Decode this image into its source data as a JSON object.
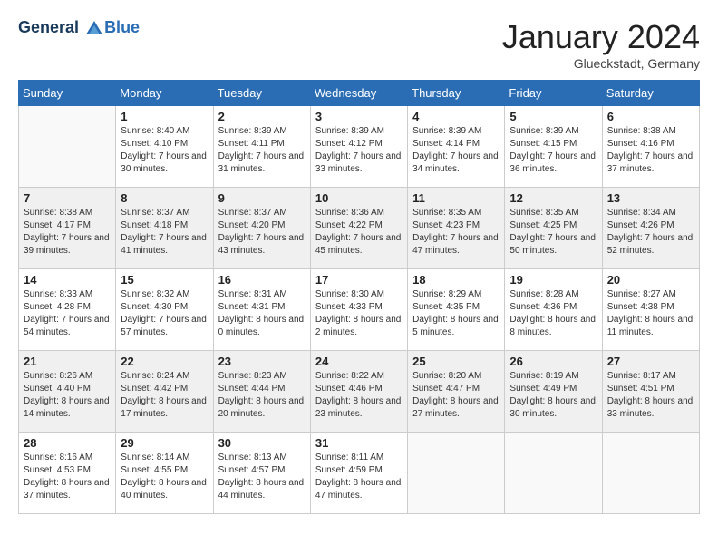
{
  "header": {
    "logo_line1": "General",
    "logo_line2": "Blue",
    "month_title": "January 2024",
    "location": "Glueckstadt, Germany"
  },
  "weekdays": [
    "Sunday",
    "Monday",
    "Tuesday",
    "Wednesday",
    "Thursday",
    "Friday",
    "Saturday"
  ],
  "weeks": [
    [
      {
        "day": "",
        "sunrise": "",
        "sunset": "",
        "daylight": ""
      },
      {
        "day": "1",
        "sunrise": "Sunrise: 8:40 AM",
        "sunset": "Sunset: 4:10 PM",
        "daylight": "Daylight: 7 hours and 30 minutes."
      },
      {
        "day": "2",
        "sunrise": "Sunrise: 8:39 AM",
        "sunset": "Sunset: 4:11 PM",
        "daylight": "Daylight: 7 hours and 31 minutes."
      },
      {
        "day": "3",
        "sunrise": "Sunrise: 8:39 AM",
        "sunset": "Sunset: 4:12 PM",
        "daylight": "Daylight: 7 hours and 33 minutes."
      },
      {
        "day": "4",
        "sunrise": "Sunrise: 8:39 AM",
        "sunset": "Sunset: 4:14 PM",
        "daylight": "Daylight: 7 hours and 34 minutes."
      },
      {
        "day": "5",
        "sunrise": "Sunrise: 8:39 AM",
        "sunset": "Sunset: 4:15 PM",
        "daylight": "Daylight: 7 hours and 36 minutes."
      },
      {
        "day": "6",
        "sunrise": "Sunrise: 8:38 AM",
        "sunset": "Sunset: 4:16 PM",
        "daylight": "Daylight: 7 hours and 37 minutes."
      }
    ],
    [
      {
        "day": "7",
        "sunrise": "Sunrise: 8:38 AM",
        "sunset": "Sunset: 4:17 PM",
        "daylight": "Daylight: 7 hours and 39 minutes."
      },
      {
        "day": "8",
        "sunrise": "Sunrise: 8:37 AM",
        "sunset": "Sunset: 4:18 PM",
        "daylight": "Daylight: 7 hours and 41 minutes."
      },
      {
        "day": "9",
        "sunrise": "Sunrise: 8:37 AM",
        "sunset": "Sunset: 4:20 PM",
        "daylight": "Daylight: 7 hours and 43 minutes."
      },
      {
        "day": "10",
        "sunrise": "Sunrise: 8:36 AM",
        "sunset": "Sunset: 4:22 PM",
        "daylight": "Daylight: 7 hours and 45 minutes."
      },
      {
        "day": "11",
        "sunrise": "Sunrise: 8:35 AM",
        "sunset": "Sunset: 4:23 PM",
        "daylight": "Daylight: 7 hours and 47 minutes."
      },
      {
        "day": "12",
        "sunrise": "Sunrise: 8:35 AM",
        "sunset": "Sunset: 4:25 PM",
        "daylight": "Daylight: 7 hours and 50 minutes."
      },
      {
        "day": "13",
        "sunrise": "Sunrise: 8:34 AM",
        "sunset": "Sunset: 4:26 PM",
        "daylight": "Daylight: 7 hours and 52 minutes."
      }
    ],
    [
      {
        "day": "14",
        "sunrise": "Sunrise: 8:33 AM",
        "sunset": "Sunset: 4:28 PM",
        "daylight": "Daylight: 7 hours and 54 minutes."
      },
      {
        "day": "15",
        "sunrise": "Sunrise: 8:32 AM",
        "sunset": "Sunset: 4:30 PM",
        "daylight": "Daylight: 7 hours and 57 minutes."
      },
      {
        "day": "16",
        "sunrise": "Sunrise: 8:31 AM",
        "sunset": "Sunset: 4:31 PM",
        "daylight": "Daylight: 8 hours and 0 minutes."
      },
      {
        "day": "17",
        "sunrise": "Sunrise: 8:30 AM",
        "sunset": "Sunset: 4:33 PM",
        "daylight": "Daylight: 8 hours and 2 minutes."
      },
      {
        "day": "18",
        "sunrise": "Sunrise: 8:29 AM",
        "sunset": "Sunset: 4:35 PM",
        "daylight": "Daylight: 8 hours and 5 minutes."
      },
      {
        "day": "19",
        "sunrise": "Sunrise: 8:28 AM",
        "sunset": "Sunset: 4:36 PM",
        "daylight": "Daylight: 8 hours and 8 minutes."
      },
      {
        "day": "20",
        "sunrise": "Sunrise: 8:27 AM",
        "sunset": "Sunset: 4:38 PM",
        "daylight": "Daylight: 8 hours and 11 minutes."
      }
    ],
    [
      {
        "day": "21",
        "sunrise": "Sunrise: 8:26 AM",
        "sunset": "Sunset: 4:40 PM",
        "daylight": "Daylight: 8 hours and 14 minutes."
      },
      {
        "day": "22",
        "sunrise": "Sunrise: 8:24 AM",
        "sunset": "Sunset: 4:42 PM",
        "daylight": "Daylight: 8 hours and 17 minutes."
      },
      {
        "day": "23",
        "sunrise": "Sunrise: 8:23 AM",
        "sunset": "Sunset: 4:44 PM",
        "daylight": "Daylight: 8 hours and 20 minutes."
      },
      {
        "day": "24",
        "sunrise": "Sunrise: 8:22 AM",
        "sunset": "Sunset: 4:46 PM",
        "daylight": "Daylight: 8 hours and 23 minutes."
      },
      {
        "day": "25",
        "sunrise": "Sunrise: 8:20 AM",
        "sunset": "Sunset: 4:47 PM",
        "daylight": "Daylight: 8 hours and 27 minutes."
      },
      {
        "day": "26",
        "sunrise": "Sunrise: 8:19 AM",
        "sunset": "Sunset: 4:49 PM",
        "daylight": "Daylight: 8 hours and 30 minutes."
      },
      {
        "day": "27",
        "sunrise": "Sunrise: 8:17 AM",
        "sunset": "Sunset: 4:51 PM",
        "daylight": "Daylight: 8 hours and 33 minutes."
      }
    ],
    [
      {
        "day": "28",
        "sunrise": "Sunrise: 8:16 AM",
        "sunset": "Sunset: 4:53 PM",
        "daylight": "Daylight: 8 hours and 37 minutes."
      },
      {
        "day": "29",
        "sunrise": "Sunrise: 8:14 AM",
        "sunset": "Sunset: 4:55 PM",
        "daylight": "Daylight: 8 hours and 40 minutes."
      },
      {
        "day": "30",
        "sunrise": "Sunrise: 8:13 AM",
        "sunset": "Sunset: 4:57 PM",
        "daylight": "Daylight: 8 hours and 44 minutes."
      },
      {
        "day": "31",
        "sunrise": "Sunrise: 8:11 AM",
        "sunset": "Sunset: 4:59 PM",
        "daylight": "Daylight: 8 hours and 47 minutes."
      },
      {
        "day": "",
        "sunrise": "",
        "sunset": "",
        "daylight": ""
      },
      {
        "day": "",
        "sunrise": "",
        "sunset": "",
        "daylight": ""
      },
      {
        "day": "",
        "sunrise": "",
        "sunset": "",
        "daylight": ""
      }
    ]
  ]
}
